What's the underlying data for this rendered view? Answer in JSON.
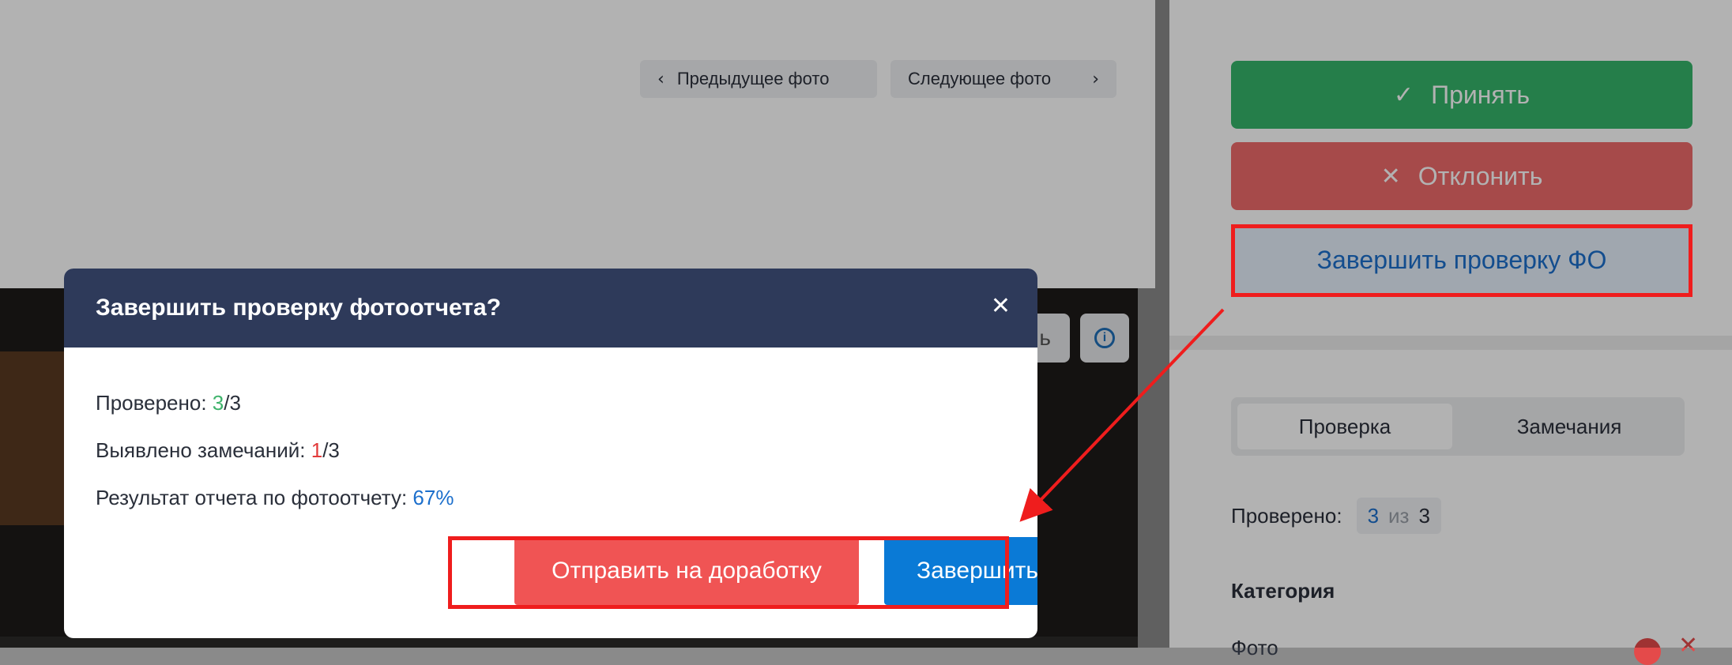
{
  "nav": {
    "prev_label": "Предыдущее фото",
    "next_label": "Следующее фото"
  },
  "toolbar": {
    "partial_label": "ь"
  },
  "actions": {
    "accept_label": "Принять",
    "reject_label": "Отклонить",
    "finish_check_label": "Завершить проверку ФО"
  },
  "tabs": [
    {
      "label": "Проверка",
      "active": true
    },
    {
      "label": "Замечания",
      "active": false
    }
  ],
  "checked": {
    "label": "Проверено:",
    "done": "3",
    "of_word": "из",
    "total": "3"
  },
  "category": {
    "heading": "Категория",
    "partial_item": "Фото"
  },
  "modal": {
    "title": "Завершить проверку фотоотчета?",
    "checked_label": "Проверено: ",
    "checked_done": "3",
    "checked_total": "/3",
    "remarks_label": "Выявлено замечаний: ",
    "remarks_count": "1",
    "remarks_total": "/3",
    "result_label": "Результат отчета по фотоотчету: ",
    "result_value": "67%",
    "send_back_label": "Отправить на доработку",
    "complete_label": "Завершить"
  },
  "colors": {
    "modal_header": "#2e3a5a",
    "accept": "#35b56a",
    "reject": "#ee6b6b",
    "primary": "#0a7ad6",
    "danger": "#f05454",
    "highlight": "#ef1d1d"
  }
}
